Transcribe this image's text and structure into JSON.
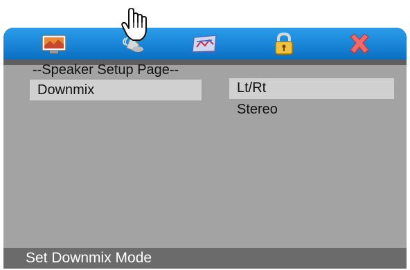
{
  "header": {
    "tabs": [
      {
        "icon": "general-setup-icon"
      },
      {
        "icon": "speaker-setup-icon",
        "selected": true
      },
      {
        "icon": "video-setup-icon"
      },
      {
        "icon": "password-lock-icon"
      },
      {
        "icon": "exit-icon"
      }
    ],
    "accent": "#1a88d8",
    "cursor_icon": "pointing-hand-icon"
  },
  "page": {
    "title": "--Speaker Setup Page--",
    "setting_label": "Downmix",
    "options": [
      "Lt/Rt",
      "Stereo"
    ],
    "selected_option": "Lt/Rt"
  },
  "status": {
    "text": "Set Downmix Mode"
  }
}
